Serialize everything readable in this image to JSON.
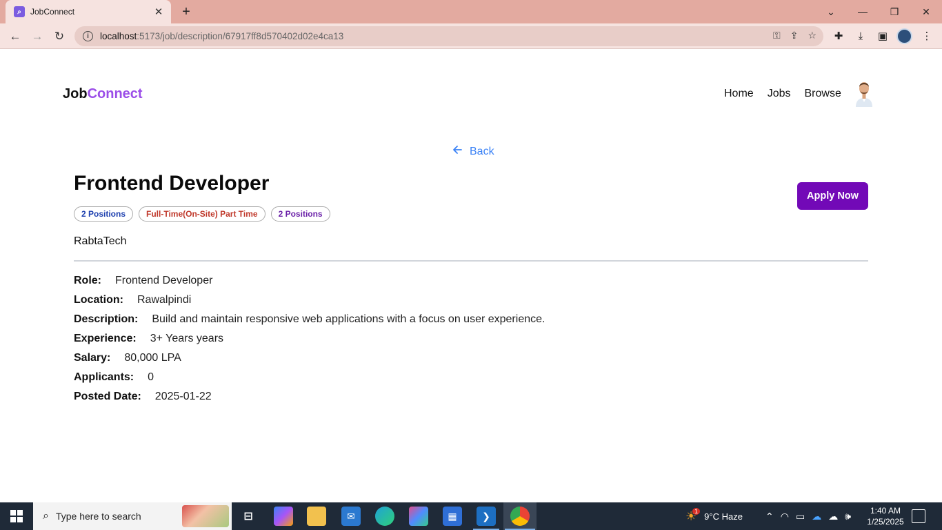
{
  "browser": {
    "tab_title": "JobConnect",
    "url_host": "localhost",
    "url_path": ":5173/job/description/67917ff8d570402d02e4ca13"
  },
  "header": {
    "logo_part1": "Job",
    "logo_part2": "Connect",
    "nav": [
      "Home",
      "Jobs",
      "Browse"
    ]
  },
  "back_label": "Back",
  "job": {
    "title": "Frontend Developer",
    "badges": [
      "2 Positions",
      "Full-Time(On-Site) Part Time",
      "2 Positions"
    ],
    "apply_label": "Apply Now",
    "company": "RabtaTech",
    "details": [
      {
        "label": "Role:",
        "value": "Frontend Developer"
      },
      {
        "label": "Location:",
        "value": "Rawalpindi"
      },
      {
        "label": "Description:",
        "value": "Build and maintain responsive web applications with a focus on user experience."
      },
      {
        "label": "Experience:",
        "value": "3+ Years years"
      },
      {
        "label": "Salary:",
        "value": "80,000 LPA"
      },
      {
        "label": "Applicants:",
        "value": "0"
      },
      {
        "label": "Posted Date:",
        "value": "2025-01-22"
      }
    ]
  },
  "taskbar": {
    "search_placeholder": "Type here to search",
    "weather": "9°C  Haze",
    "time": "1:40 AM",
    "date": "1/25/2025",
    "weather_badge": "1"
  },
  "colors": {
    "brand_purple": "#9b4de8",
    "apply_button": "#7209b7",
    "back_link": "#3b82f6",
    "chrome_frame": "#e3aaa0"
  }
}
